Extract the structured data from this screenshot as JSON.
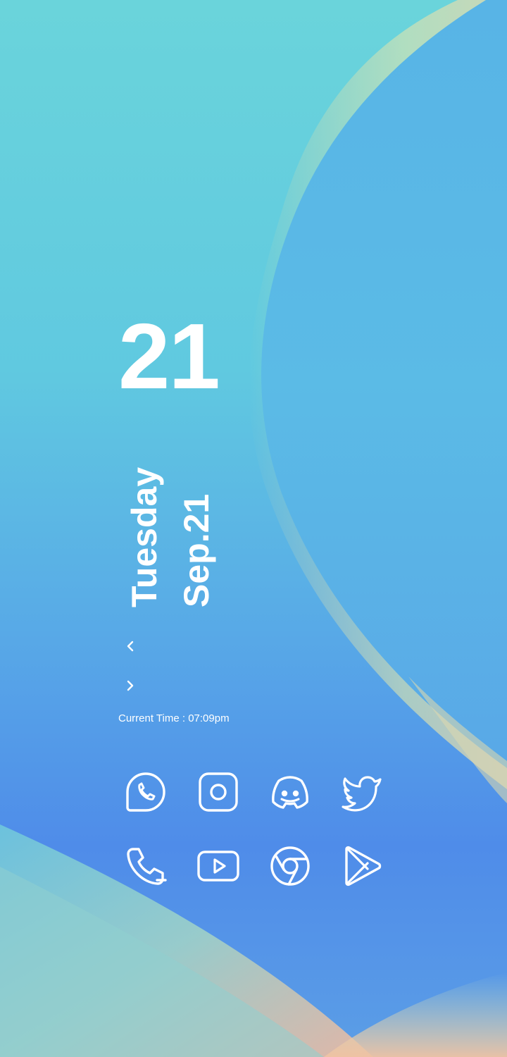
{
  "widget": {
    "day_number": "21",
    "weekday": "Tuesday",
    "date": "Sep.21",
    "prev_icon": "chevron-left-icon",
    "next_icon": "chevron-right-icon",
    "current_time_label": "Current Time : ",
    "current_time_value": "07:09pm"
  },
  "apps": [
    {
      "icon": "whatsapp-icon"
    },
    {
      "icon": "instagram-icon"
    },
    {
      "icon": "discord-icon"
    },
    {
      "icon": "twitter-icon"
    },
    {
      "icon": "phone-icon"
    },
    {
      "icon": "youtube-icon"
    },
    {
      "icon": "chrome-icon"
    },
    {
      "icon": "play-store-icon"
    }
  ],
  "colors": {
    "text": "#ffffff",
    "background_top": "#63d0dd",
    "background_blue": "#4f8ce8",
    "accent_peach": "#f2bfa0"
  }
}
